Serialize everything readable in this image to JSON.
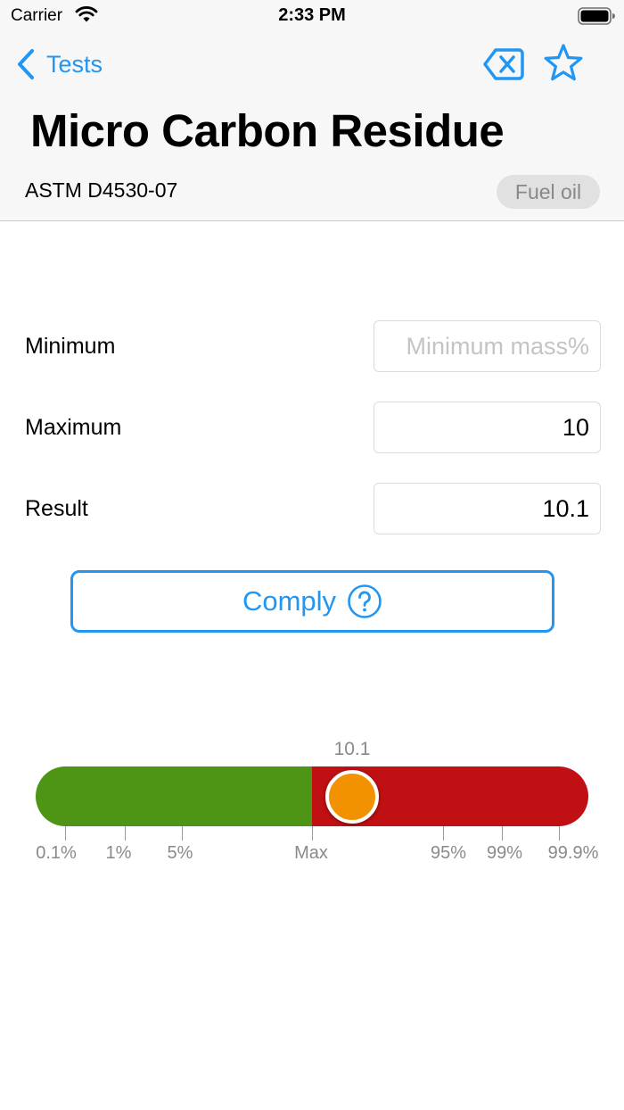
{
  "status_bar": {
    "carrier": "Carrier",
    "time": "2:33 PM"
  },
  "nav": {
    "back_label": "Tests",
    "clear_icon": "delete-backward-icon",
    "favorite_icon": "star-icon"
  },
  "header": {
    "title": "Micro Carbon Residue",
    "standard": "ASTM D4530-07",
    "category": "Fuel oil"
  },
  "form": {
    "minimum": {
      "label": "Minimum",
      "value": "",
      "placeholder": "Minimum mass%"
    },
    "maximum": {
      "label": "Maximum",
      "value": "10",
      "placeholder": ""
    },
    "result": {
      "label": "Result",
      "value": "10.1",
      "placeholder": ""
    }
  },
  "comply": {
    "label": "Comply",
    "icon": "question-circle-icon"
  },
  "gauge": {
    "value_label": "10.1",
    "ticks": [
      "0.1%",
      "1%",
      "5%",
      "Max",
      "95%",
      "99%",
      "99.9%"
    ],
    "colors": {
      "pass": "#4e9415",
      "fail": "#c11014",
      "knob": "#f39200"
    }
  },
  "colors": {
    "accent": "#2196f3"
  }
}
